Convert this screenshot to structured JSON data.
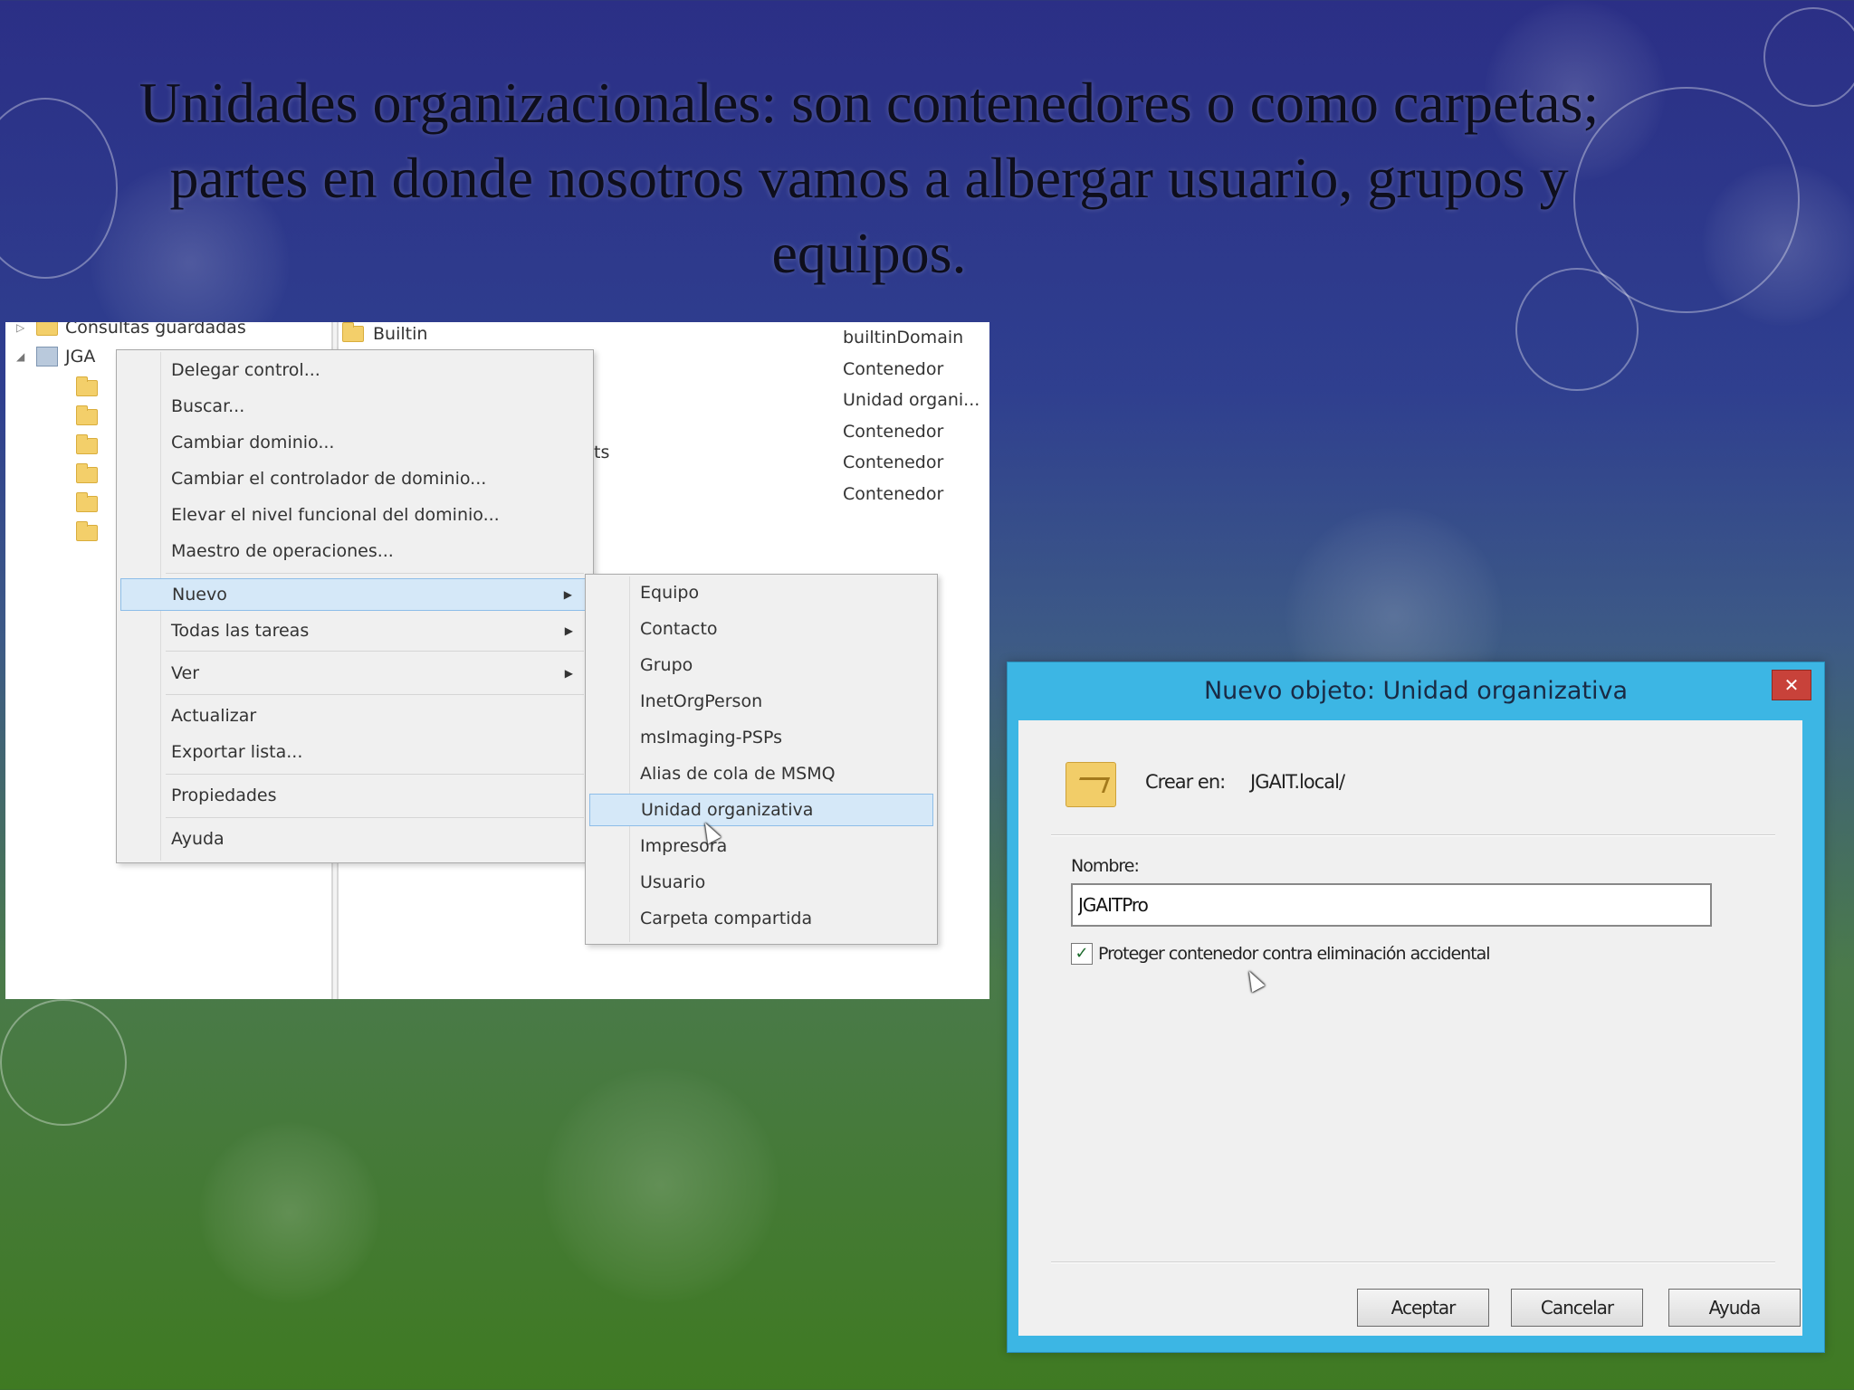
{
  "slide": {
    "title_lines": [
      "Unidades organizacionales: son contenedores o como carpetas;",
      "partes en donde nosotros vamos a albergar usuario, grupos y",
      "equipos."
    ]
  },
  "aduc": {
    "tree": {
      "saved_queries": "Consultas guardadas",
      "domain_node": "JGA"
    },
    "list": {
      "builtin": "Builtin",
      "fragment": "ts",
      "types": [
        "builtinDomain",
        "Contenedor",
        "Unidad organi...",
        "Contenedor",
        "Contenedor",
        "Contenedor"
      ]
    },
    "context_menu": {
      "items": [
        "Delegar control...",
        "Buscar...",
        "Cambiar dominio...",
        "Cambiar el controlador de dominio...",
        "Elevar el nivel funcional del dominio...",
        "Maestro de operaciones...",
        "Nuevo",
        "Todas las tareas",
        "Ver",
        "Actualizar",
        "Exportar lista...",
        "Propiedades",
        "Ayuda"
      ],
      "highlighted": "Nuevo"
    },
    "submenu": {
      "items": [
        "Equipo",
        "Contacto",
        "Grupo",
        "InetOrgPerson",
        "msImaging-PSPs",
        "Alias de cola de MSMQ",
        "Unidad organizativa",
        "Impresora",
        "Usuario",
        "Carpeta compartida"
      ],
      "highlighted": "Unidad organizativa"
    }
  },
  "dialog": {
    "title": "Nuevo objeto: Unidad organizativa",
    "close_glyph": "✕",
    "create_in_label": "Crear en:",
    "create_in_path": "JGAIT.local/",
    "name_label": "Nombre:",
    "name_value": "JGAITPro",
    "protect_label": "Proteger contenedor contra eliminación accidental",
    "protect_checked": true,
    "buttons": {
      "ok": "Aceptar",
      "cancel": "Cancelar",
      "help": "Ayuda"
    }
  },
  "colors": {
    "dialog_frame": "#3cb6e4",
    "close_button": "#c8423a",
    "menu_highlight": "#d5e8f8"
  }
}
